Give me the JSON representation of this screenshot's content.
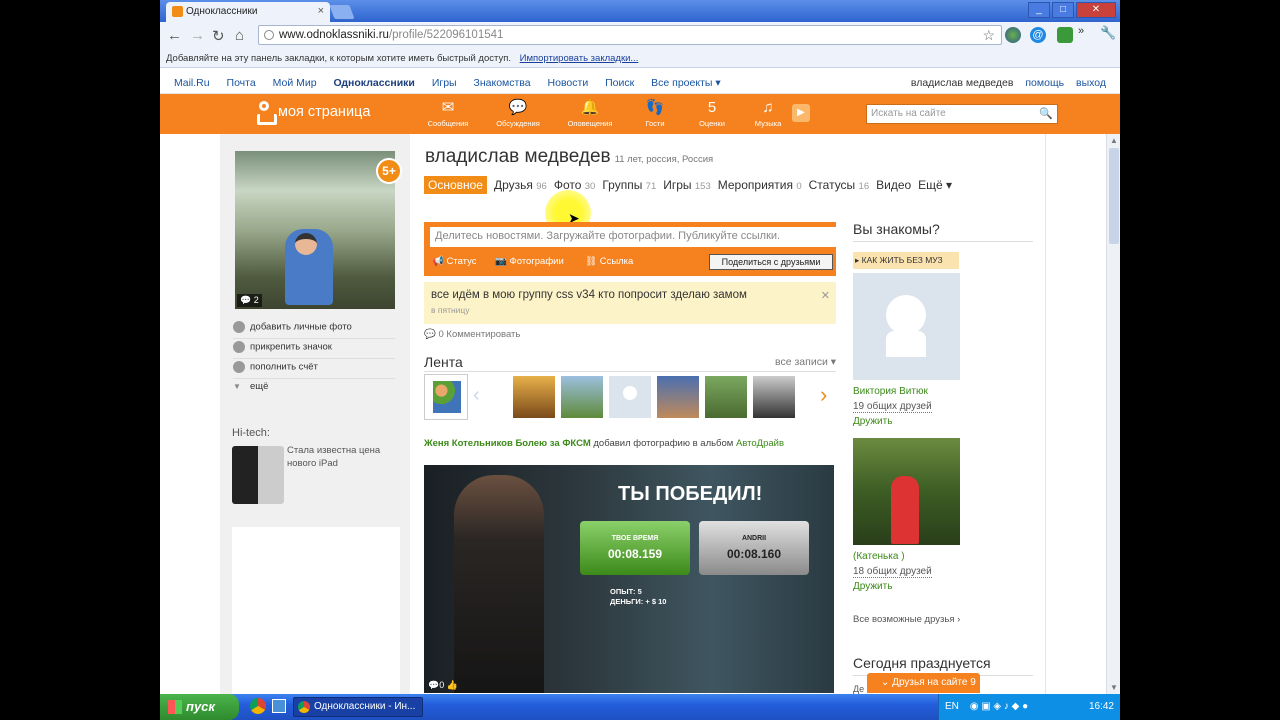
{
  "browser": {
    "tab_title": "Одноклассники",
    "tab_close": "×",
    "window_controls": [
      "_",
      "□",
      "✕"
    ],
    "url_host": "www.odnoklassniki.ru",
    "url_path": "/profile/522096101541",
    "bookmarks_text": "Добавляйте на эту панель закладки, к которым хотите иметь быстрый доступ.",
    "bookmarks_import": "Импортировать закладки..."
  },
  "mailbar": {
    "links": [
      "Mail.Ru",
      "Почта",
      "Мой Мир",
      "Одноклассники",
      "Игры",
      "Знакомства",
      "Новости",
      "Поиск",
      "Все проекты ▾"
    ],
    "user": "владислав медведев",
    "help": "помощь",
    "logout": "выход"
  },
  "orangebar": {
    "logo": "моя страница",
    "nav": [
      {
        "icon": "✉",
        "label": "Сообщения"
      },
      {
        "icon": "💬",
        "label": "Обсуждения"
      },
      {
        "icon": "🔔",
        "label": "Оповещения"
      },
      {
        "icon": "👣",
        "label": "Гости"
      },
      {
        "icon": "5",
        "label": "Оценки"
      },
      {
        "icon": "♫",
        "label": "Музыка"
      }
    ],
    "search_placeholder": "Искать на сайте"
  },
  "profile": {
    "name": "владислав медведев",
    "meta": "11 лет, россия, Россия",
    "badge": "5+",
    "photo_comments": "2",
    "left_links": [
      "добавить личные фото",
      "прикрепить значок",
      "пополнить счёт",
      "ещё"
    ],
    "ad_title": "Hi-tech:",
    "ad_text": "Стала известна цена нового iPad",
    "tabs": [
      {
        "label": "Основное",
        "count": ""
      },
      {
        "label": "Друзья",
        "count": "96"
      },
      {
        "label": "Фото",
        "count": "30"
      },
      {
        "label": "Группы",
        "count": "71"
      },
      {
        "label": "Игры",
        "count": "153"
      },
      {
        "label": "Мероприятия",
        "count": "0"
      },
      {
        "label": "Статусы",
        "count": "16"
      },
      {
        "label": "Видео",
        "count": ""
      },
      {
        "label": "Ещё ▾",
        "count": ""
      }
    ]
  },
  "share": {
    "placeholder": "Делитесь новостями. Загружайте фотографии. Публикуйте ссылки.",
    "status": "Статус",
    "photos": "Фотографии",
    "link": "Ссылка",
    "button": "Поделиться с друзьями"
  },
  "status_post": {
    "text": "все идём в мою группу css v34 кто попросит зделаю замом",
    "when": "в пятницу",
    "comment": "0 Комментировать"
  },
  "feed": {
    "title": "Лента",
    "all": "все записи ▾",
    "author": "Женя Котельников Болею за ФКСМ",
    "action": "добавил фотографию в альбом",
    "album": "АвтоДрайв",
    "image": {
      "headline": "ТЫ ПОБЕДИЛ!",
      "box1_label": "ТВОЕ ВРЕМЯ",
      "box1_time": "00:08.159",
      "box2_label": "ANDRII",
      "box2_time": "00:08.160",
      "xp": "ОПЫТ:      5",
      "money": "ДЕНЬГИ: + $ 10",
      "comments": "0"
    }
  },
  "right": {
    "title": "Вы знакомы?",
    "tag": "▸ КАК ЖИТЬ БЕЗ МУЗ",
    "friends": [
      {
        "name": "Виктория Витюк",
        "mutual": "19 общих друзей",
        "add": "Дружить"
      },
      {
        "name": "(Катенька )",
        "mutual": "18 общих друзей",
        "add": "Дружить"
      }
    ],
    "all_friends": "Все возможные друзья ›",
    "today_title": "Сегодня празднуется",
    "today_text": "Де",
    "friends_online": "Друзья на сайте 9"
  },
  "taskbar": {
    "start": "пуск",
    "task": "Одноклассники - Ин...",
    "lang": "EN",
    "time": "16:42"
  }
}
